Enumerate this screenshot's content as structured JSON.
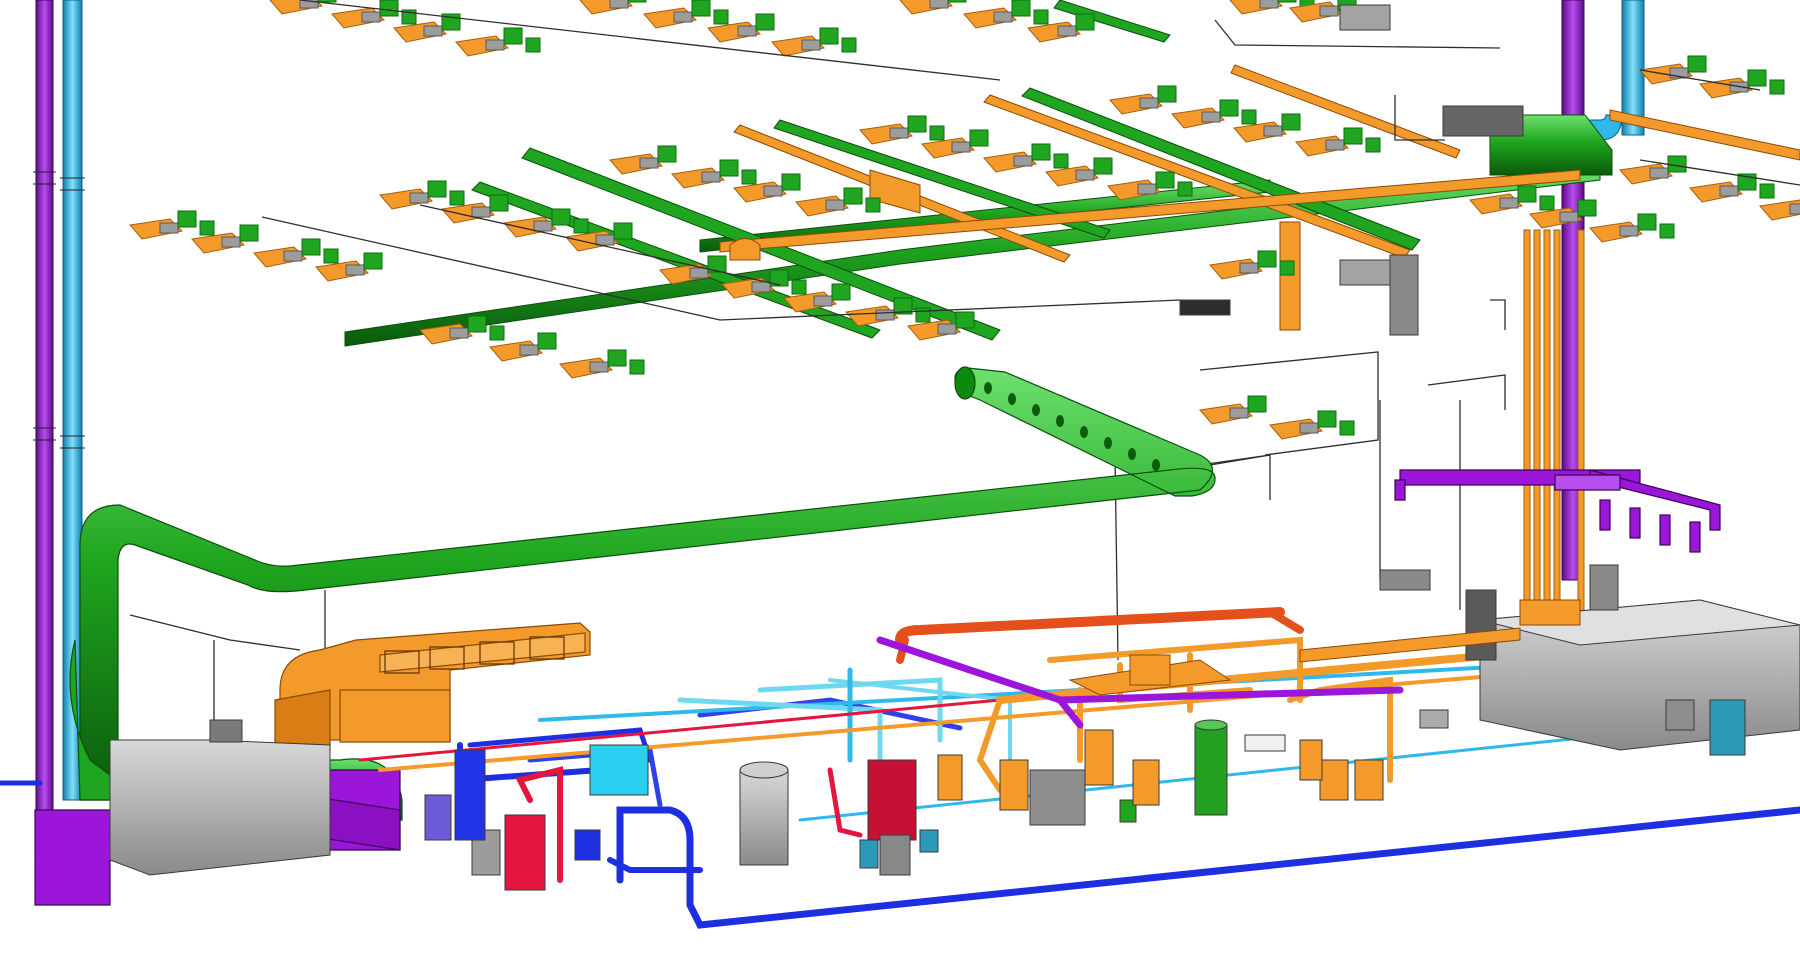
{
  "scene": {
    "type": "isometric MEP model view",
    "background": "#ffffff",
    "colors": {
      "supply_duct": "#1fa51f",
      "supply_duct_dark": "#0d6e0d",
      "chilled_pipe": "#f39a2a",
      "chilled_pipe_dark": "#a85d0b",
      "exhaust": "#9b16d8",
      "exhaust_dark": "#5e0a87",
      "water_riser": "#2fb8ea",
      "water_riser_dark": "#117ea8",
      "blue_pipe": "#1d2fe0",
      "blue_pipe_dark": "#0a1590",
      "red_pipe": "#e4163f",
      "red_pipe_dark": "#8d0a24",
      "cyan_pipe": "#6fd8f0",
      "orange_red_pipe": "#e3501c",
      "equipment_grey": "#9c9c9c",
      "equipment_grey_dark": "#5a5a5a",
      "thin_line": "#1d1d1d"
    },
    "icons": [
      "vav-box-icon",
      "diffuser-icon",
      "fan-coil-icon",
      "pump-icon",
      "tank-icon"
    ]
  }
}
